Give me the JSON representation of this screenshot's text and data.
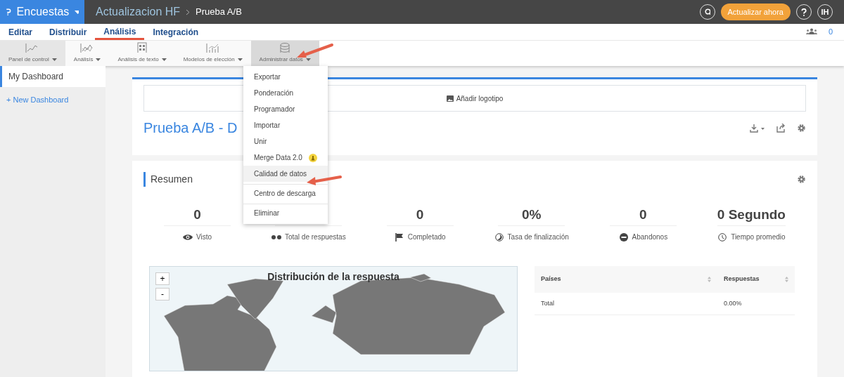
{
  "topbar": {
    "product": "Encuestas",
    "breadcrumb": [
      "Actualizacion HF",
      "Prueba A/B"
    ],
    "upgrade_button": "Actualizar ahora",
    "user_initials": "IH"
  },
  "tabs": [
    {
      "label": "Editar",
      "selected": false
    },
    {
      "label": "Distribuir",
      "selected": false
    },
    {
      "label": "Análisis",
      "selected": true
    },
    {
      "label": "Integración",
      "selected": false
    }
  ],
  "collaborators_count": "0",
  "toolbar": [
    {
      "label": "Panel de control",
      "selected": true,
      "open": false
    },
    {
      "label": "Análisis",
      "selected": false,
      "open": false
    },
    {
      "label": "Análisis de texto",
      "selected": false,
      "open": false
    },
    {
      "label": "Modelos de elección",
      "selected": false,
      "open": false
    },
    {
      "label": "Administrar datos",
      "selected": false,
      "open": true
    }
  ],
  "sidebar": {
    "items": [
      {
        "label": "My Dashboard",
        "selected": true
      }
    ],
    "new_link": "+ New Dashboard"
  },
  "menu": [
    {
      "label": "Exportar",
      "hovered": false,
      "divider_before": false,
      "badge": false
    },
    {
      "label": "Ponderación",
      "hovered": false,
      "divider_before": false,
      "badge": false
    },
    {
      "label": "Programador",
      "hovered": false,
      "divider_before": false,
      "badge": false
    },
    {
      "label": "Importar",
      "hovered": false,
      "divider_before": false,
      "badge": false
    },
    {
      "label": "Unir",
      "hovered": false,
      "divider_before": false,
      "badge": false
    },
    {
      "label": "Merge Data 2.0",
      "hovered": false,
      "divider_before": false,
      "badge": true
    },
    {
      "label": "Calidad de datos",
      "hovered": true,
      "divider_before": false,
      "badge": false
    },
    {
      "label": "Centro de descarga",
      "hovered": false,
      "divider_before": true,
      "badge": false
    },
    {
      "label": "Eliminar",
      "hovered": false,
      "divider_before": true,
      "badge": false
    }
  ],
  "dashboard": {
    "logo_button": "Añadir logotipo",
    "title": "Prueba A/B - D"
  },
  "summary": {
    "title": "Resumen",
    "stats": [
      {
        "value": "0",
        "label": "Visto"
      },
      {
        "label": "Total de respuestas"
      },
      {
        "value": "0",
        "label": "Completado"
      },
      {
        "value": "0%",
        "label": "Tasa de finalización"
      },
      {
        "value": "0",
        "label": "Abandonos"
      },
      {
        "value": "0 Segundo",
        "label": "Tiempo promedio"
      }
    ]
  },
  "map": {
    "title": "Distribución de la respuesta",
    "zoom_in": "+",
    "zoom_out": "-"
  },
  "table": {
    "columns": [
      "Países",
      "Respuestas"
    ],
    "rows": [
      [
        "Total",
        "0.00%"
      ]
    ]
  }
}
